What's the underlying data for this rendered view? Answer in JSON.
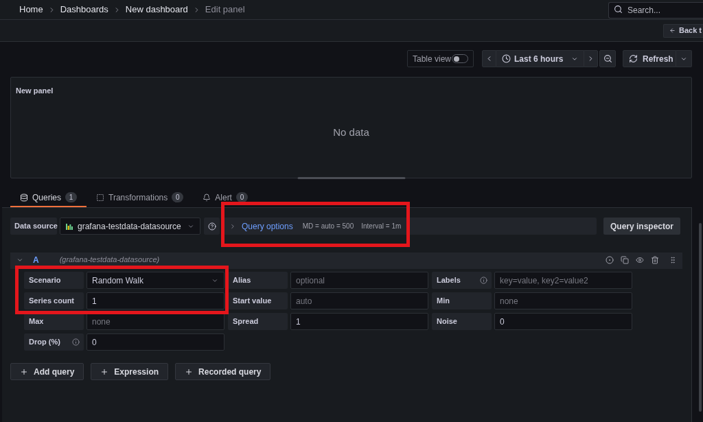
{
  "breadcrumbs": [
    {
      "label": "Home",
      "current": false
    },
    {
      "label": "Dashboards",
      "current": false
    },
    {
      "label": "New dashboard",
      "current": false
    },
    {
      "label": "Edit panel",
      "current": true
    }
  ],
  "search": {
    "placeholder": "Search..."
  },
  "back_button": {
    "label": "Back t"
  },
  "toolbar": {
    "table_view": {
      "label": "Table view",
      "on": false
    },
    "time_range": {
      "label": "Last 6 hours"
    },
    "refresh": {
      "label": "Refresh"
    }
  },
  "panel": {
    "title": "New panel",
    "message": "No data"
  },
  "tabs": [
    {
      "label": "Queries",
      "count": "1",
      "selected": true
    },
    {
      "label": "Transformations",
      "count": "0",
      "selected": false
    },
    {
      "label": "Alert",
      "count": "0",
      "selected": false
    }
  ],
  "data_source": {
    "label": "Data source",
    "value": "grafana-testdata-datasource"
  },
  "query_options": {
    "label": "Query options",
    "expanded": false,
    "highlighted": true,
    "stats": [
      "MD = auto = 500",
      "Interval = 1m"
    ]
  },
  "query_inspector": {
    "label": "Query inspector"
  },
  "query": {
    "ref": "A",
    "source": "(grafana-testdata-datasource)",
    "expanded": true,
    "rows": [
      [
        {
          "label": "Scenario",
          "info": false,
          "kind": "select",
          "value": "Random Walk",
          "highlighted": true
        },
        {
          "label": "Alias",
          "info": false,
          "kind": "input",
          "placeholder": "optional",
          "highlighted": false
        },
        {
          "label": "Labels",
          "info": true,
          "kind": "input",
          "placeholder": "key=value, key2=value2",
          "highlighted": false
        }
      ],
      [
        {
          "label": "Series count",
          "info": false,
          "kind": "input",
          "value": "1",
          "highlighted": true
        },
        {
          "label": "Start value",
          "info": false,
          "kind": "input",
          "placeholder": "auto",
          "highlighted": false
        },
        {
          "label": "Min",
          "info": false,
          "kind": "input",
          "placeholder": "none",
          "highlighted": false
        }
      ],
      [
        {
          "label": "Max",
          "info": false,
          "kind": "input",
          "placeholder": "none",
          "highlighted": false
        },
        {
          "label": "Spread",
          "info": false,
          "kind": "input",
          "value": "1",
          "highlighted": false
        },
        {
          "label": "Noise",
          "info": false,
          "kind": "input",
          "value": "0",
          "highlighted": false
        }
      ],
      [
        {
          "label": "Drop (%)",
          "info": true,
          "kind": "input",
          "value": "0",
          "highlighted": false
        }
      ]
    ]
  },
  "actions": [
    {
      "label": "Add query"
    },
    {
      "label": "Expression"
    },
    {
      "label": "Recorded query"
    }
  ]
}
